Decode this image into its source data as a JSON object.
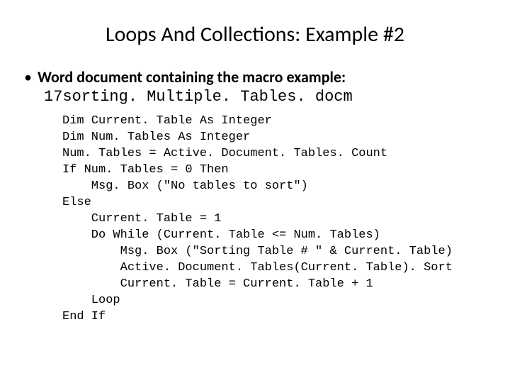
{
  "title": "Loops And Collections: Example #2",
  "bullet": "Word document containing the macro example:",
  "filename": "17sorting. Multiple. Tables. docm",
  "code": "Dim Current. Table As Integer\nDim Num. Tables As Integer\nNum. Tables = Active. Document. Tables. Count\nIf Num. Tables = 0 Then\n    Msg. Box (\"No tables to sort\")\nElse\n    Current. Table = 1\n    Do While (Current. Table <= Num. Tables)\n        Msg. Box (\"Sorting Table # \" & Current. Table)\n        Active. Document. Tables(Current. Table). Sort\n        Current. Table = Current. Table + 1\n    Loop\nEnd If"
}
